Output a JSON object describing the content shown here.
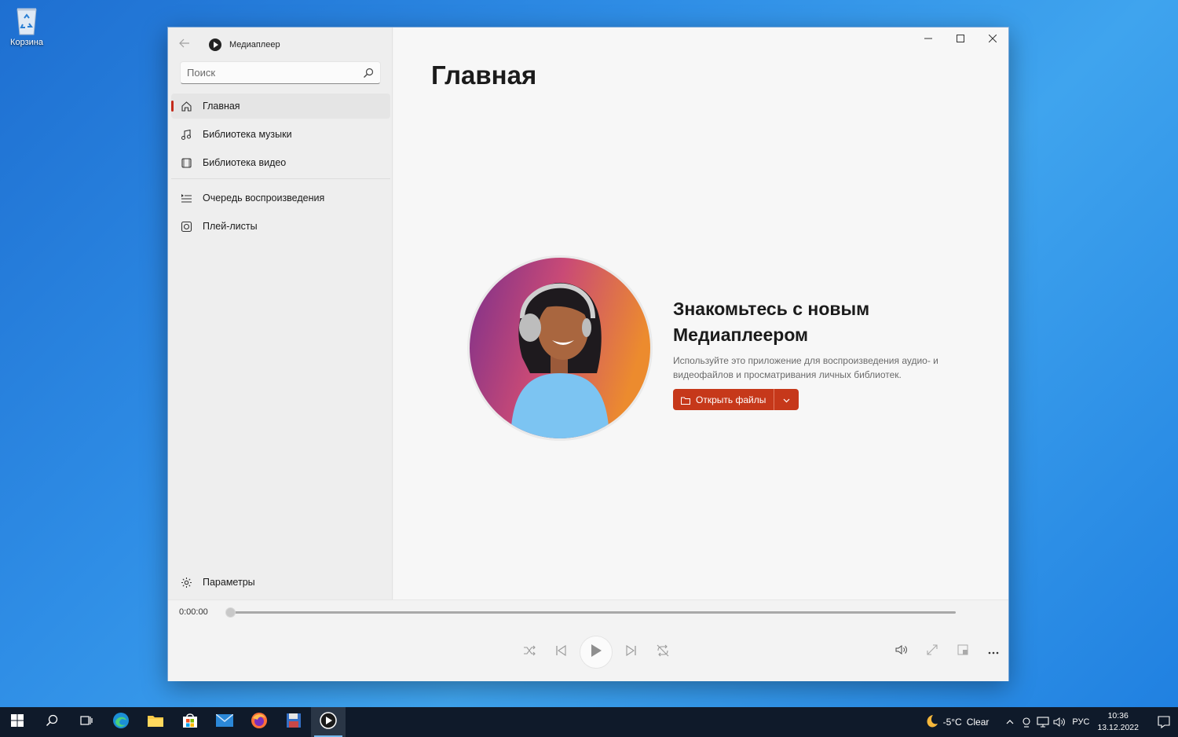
{
  "desktop": {
    "recycle_bin_label": "Корзина"
  },
  "app": {
    "title": "Медиаплеер"
  },
  "search": {
    "placeholder": "Поиск"
  },
  "nav": {
    "items": [
      {
        "label": "Главная",
        "icon": "home-icon",
        "active": true
      },
      {
        "label": "Библиотека музыки",
        "icon": "music-note-icon"
      },
      {
        "label": "Библиотека видео",
        "icon": "video-icon"
      },
      {
        "label": "Очередь воспроизведения",
        "icon": "queue-icon"
      },
      {
        "label": "Плей-листы",
        "icon": "playlist-icon"
      }
    ],
    "settings_label": "Параметры"
  },
  "main": {
    "page_title": "Главная",
    "hero_heading": "Знакомьтесь с новым Медиаплеером",
    "hero_description": "Используйте это приложение для воспроизведения аудио- и видеофайлов и просматривания личных библиотек.",
    "open_files_label": "Открыть файлы"
  },
  "player": {
    "current_time": "0:00:00",
    "progress": 0
  },
  "taskbar": {
    "temperature": "-5°C",
    "weather": "Clear",
    "language": "РУС",
    "time": "10:36",
    "date": "13.12.2022"
  },
  "colors": {
    "accent": "#c6381a",
    "active_indicator": "#c42b1c",
    "taskbar": "#0f1a2a"
  }
}
